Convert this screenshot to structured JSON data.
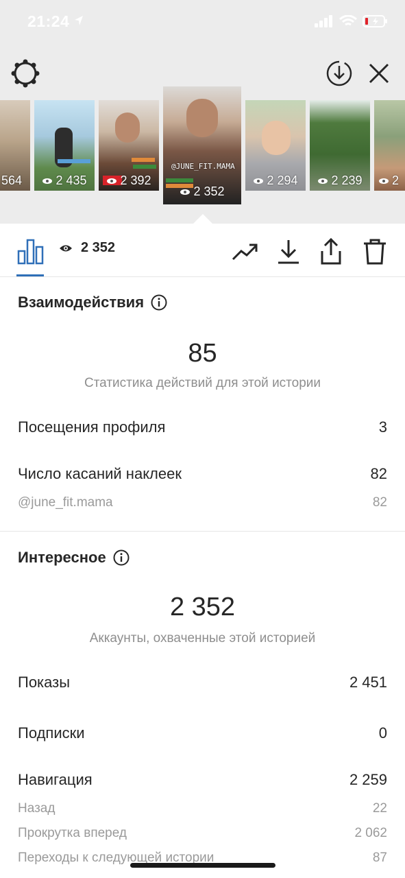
{
  "status_bar": {
    "time": "21:24"
  },
  "thumbnails": [
    {
      "views": "564"
    },
    {
      "views": "2 435"
    },
    {
      "views": "2 392"
    },
    {
      "views": "2 352",
      "handle": "@JUNE_FIT.MAMA",
      "selected": true
    },
    {
      "views": "2 294"
    },
    {
      "views": "2 239"
    },
    {
      "views": "2"
    }
  ],
  "toolbar": {
    "views_count": "2 352"
  },
  "interactions": {
    "title": "Взаимодействия",
    "total": "85",
    "total_caption": "Статистика действий для этой истории",
    "rows": [
      {
        "label": "Посещения профиля",
        "value": "3"
      },
      {
        "label": "Число касаний наклеек",
        "value": "82"
      },
      {
        "label": "@june_fit.mama",
        "value": "82"
      }
    ]
  },
  "discovery": {
    "title": "Интересное",
    "total": "2 352",
    "total_caption": "Аккаунты, охваченные этой историей",
    "rows": [
      {
        "label": "Показы",
        "value": "2 451"
      },
      {
        "label": "Подписки",
        "value": "0"
      },
      {
        "label": "Навигация",
        "value": "2 259"
      },
      {
        "label": "Назад",
        "value": "22"
      },
      {
        "label": "Прокрутка вперед",
        "value": "2 062"
      },
      {
        "label": "Переходы к следующей истории",
        "value": "87"
      }
    ]
  },
  "colors": {
    "accent": "#2f6fb8",
    "text": "#262626",
    "muted": "#8e8e8e",
    "top_bg": "#ececec"
  },
  "icons": [
    "settings-icon",
    "download-circle-icon",
    "close-icon",
    "bar-chart-icon",
    "eye-icon",
    "trend-icon",
    "download-icon",
    "share-icon",
    "trash-icon",
    "info-icon"
  ]
}
